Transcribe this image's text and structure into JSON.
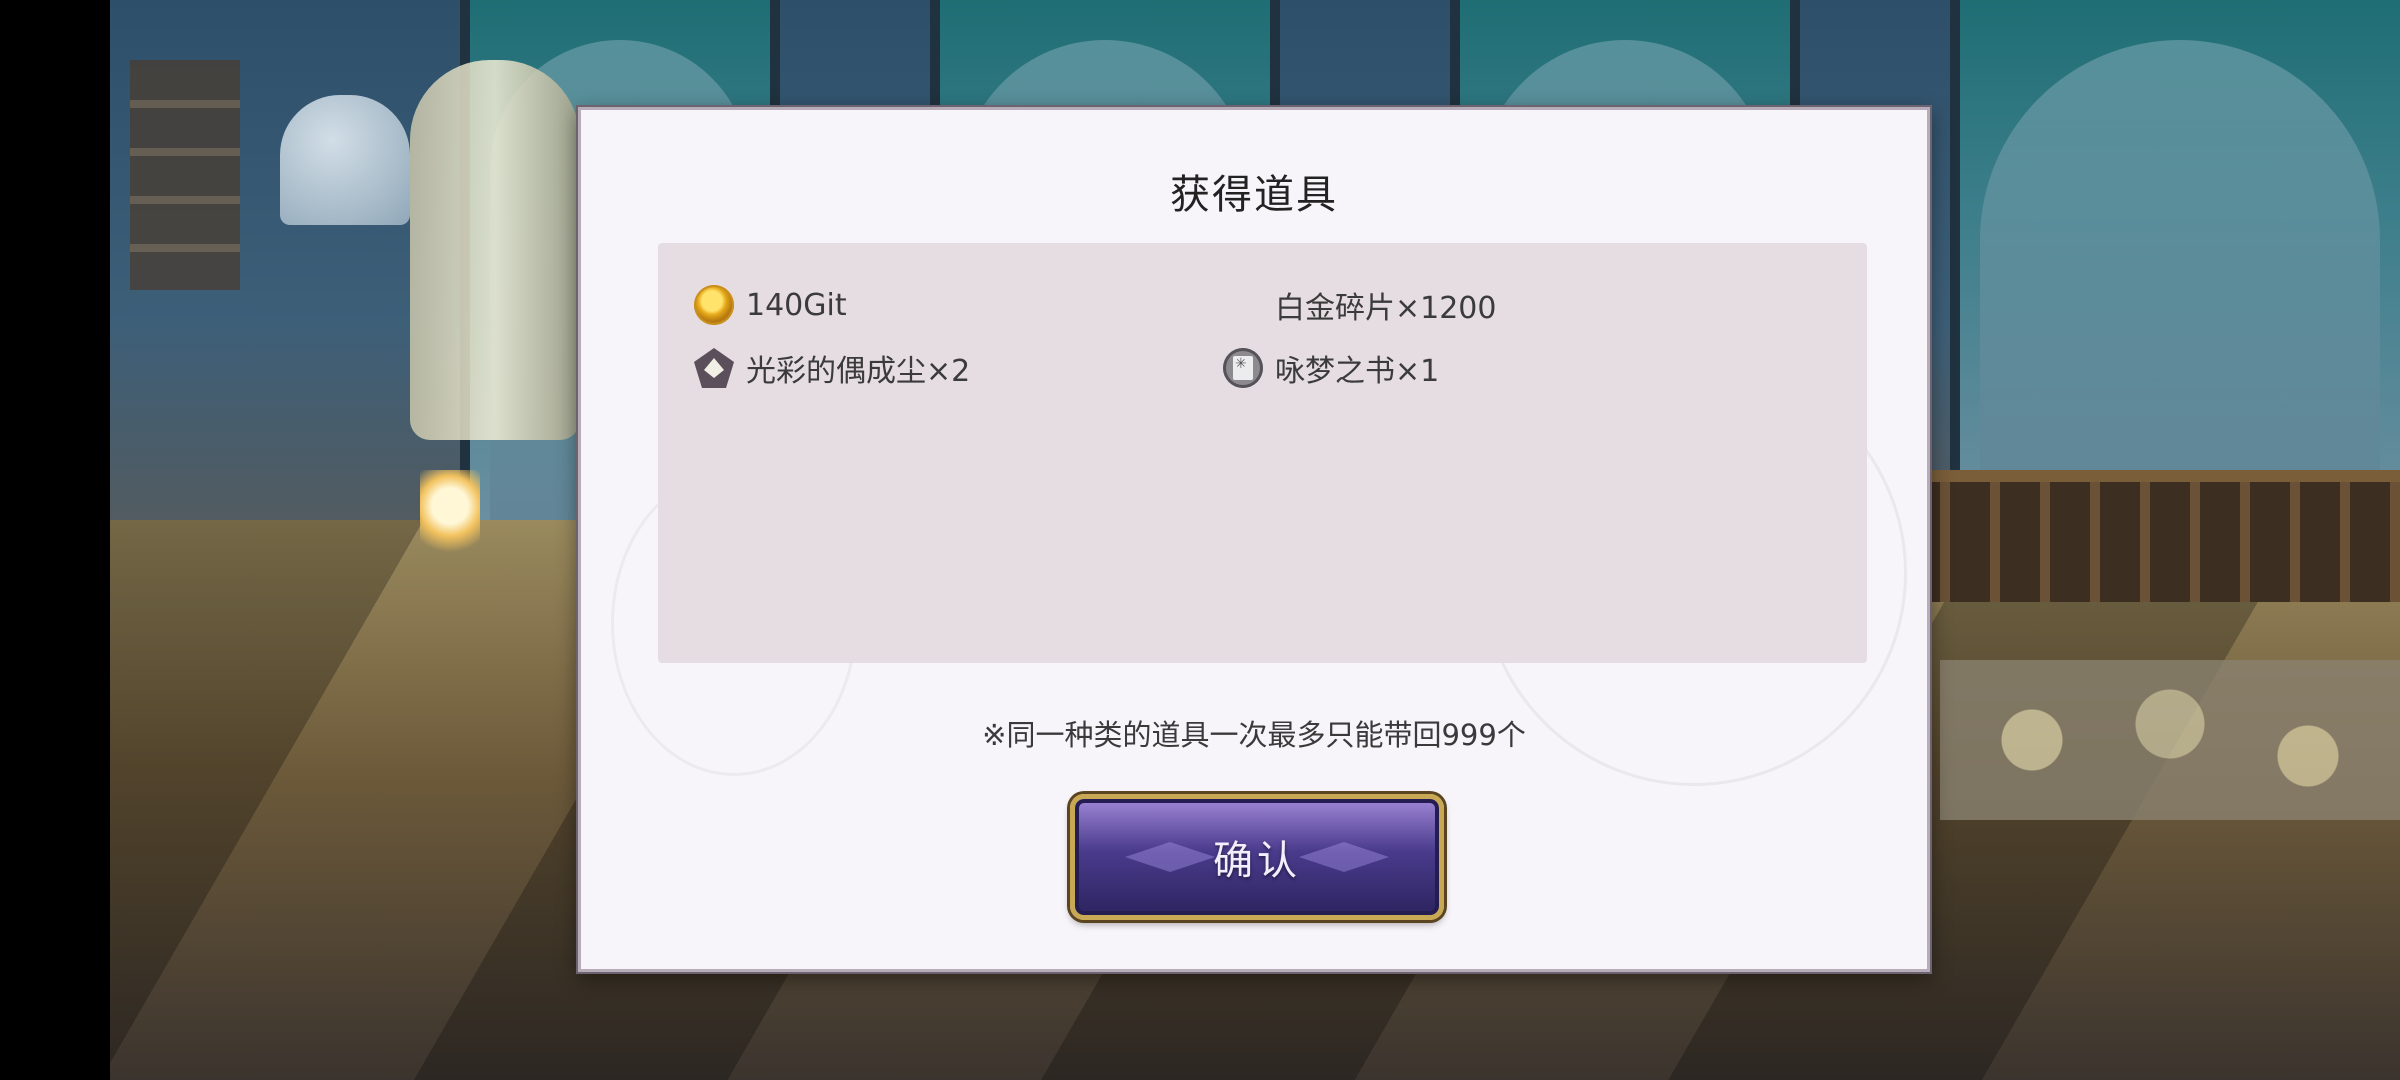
{
  "dialog": {
    "title": "获得道具",
    "items": [
      {
        "icon": "coin-icon",
        "label": "140Git"
      },
      {
        "icon": "",
        "label": "白金碎片×1200"
      },
      {
        "icon": "dust-icon",
        "label": "光彩的偶成尘×2"
      },
      {
        "icon": "book-icon",
        "label": "咏梦之书×1"
      }
    ],
    "note": "※同一种类的道具一次最多只能带回999个",
    "confirm_label": "确认"
  },
  "colors": {
    "dialog_bg": "#f7f5fa",
    "panel_bg": "#e6dde2",
    "button_purple": "#4a3b8c",
    "button_border_gold": "#c9a855"
  }
}
